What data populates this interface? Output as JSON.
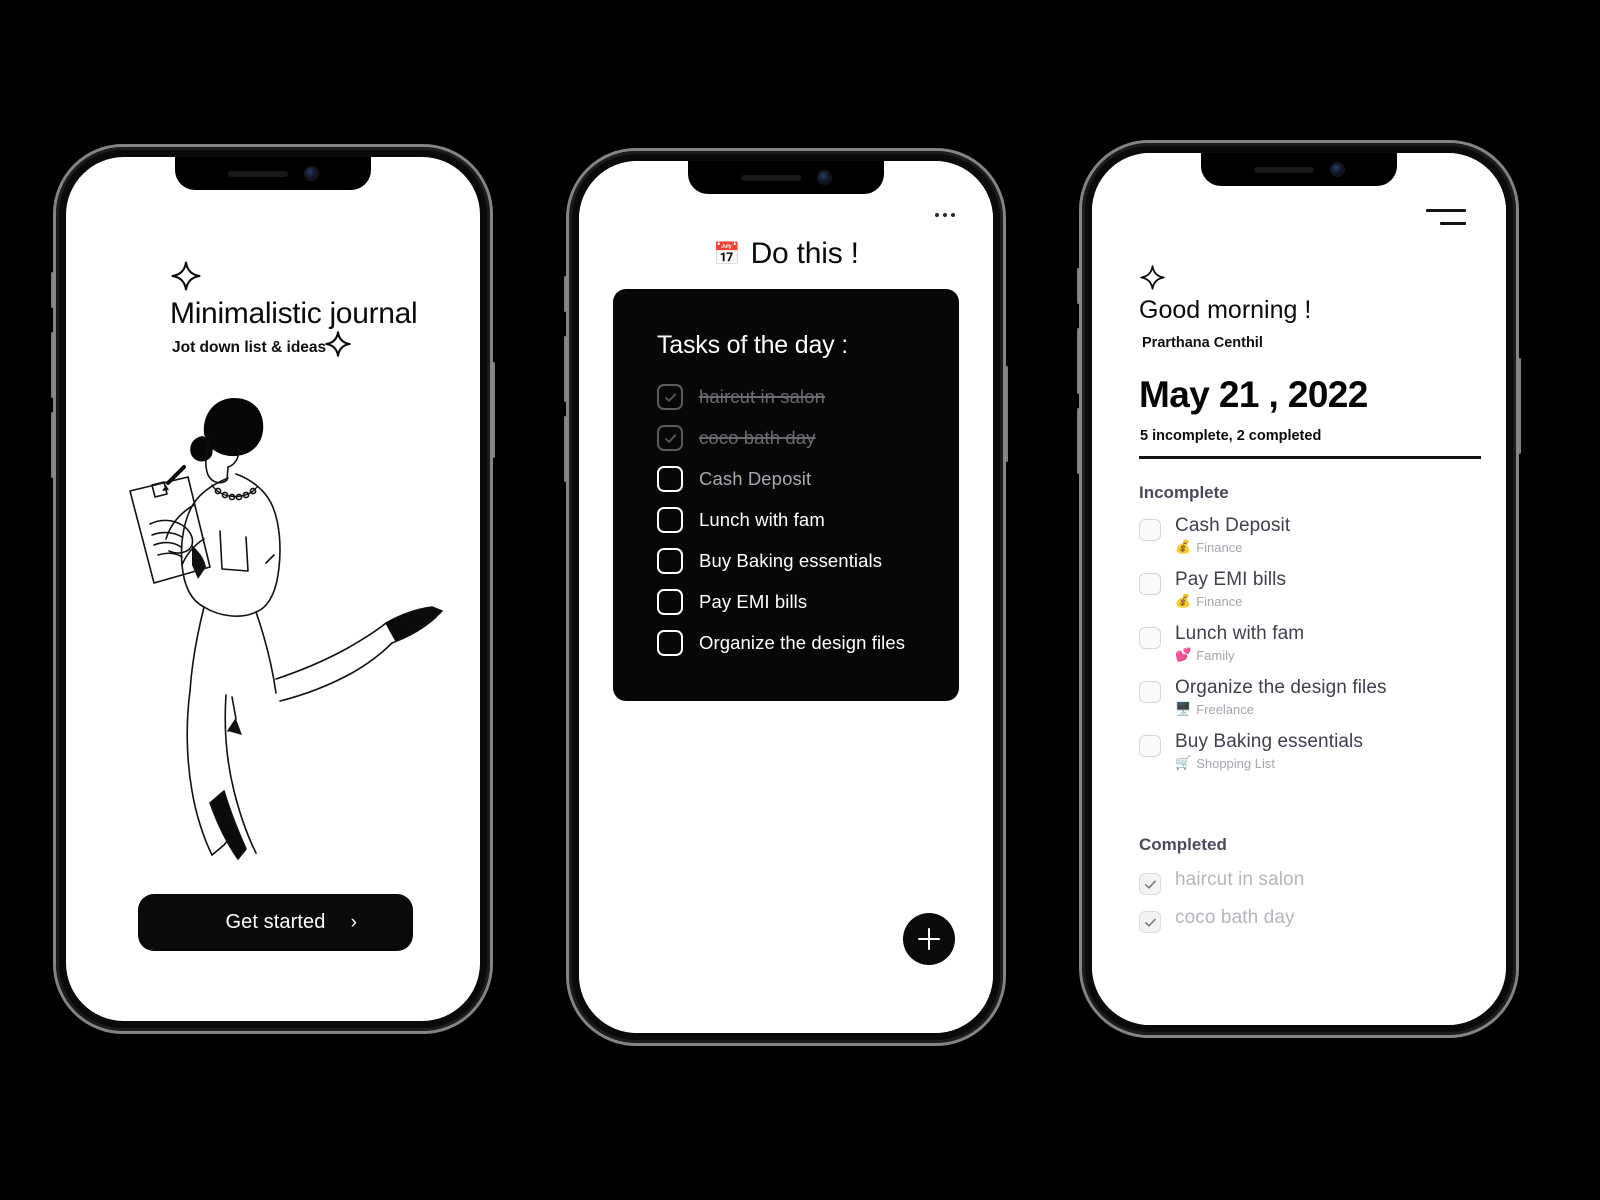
{
  "meta": {
    "accent_black": "#0a0a0a",
    "muted_gray": "#a6a6b0",
    "section_gray": "#4b4a5c"
  },
  "screen1": {
    "name": "onboarding",
    "sparkle_icon": "sparkle-icon",
    "title": "Minimalistic journal",
    "subtitle": "Jot down list & ideas",
    "illustration_alt": "woman-writing-on-clipboard-illustration",
    "cta": {
      "label": "Get started",
      "arrow": "›"
    }
  },
  "screen2": {
    "name": "tasks-of-the-day",
    "overflow_icon": "more-options-icon",
    "header_emoji": "📅",
    "header_title": "Do this !",
    "card_title": "Tasks of the day :",
    "tasks": [
      {
        "label": "haircut in salon",
        "state": "done"
      },
      {
        "label": "coco bath day",
        "state": "done"
      },
      {
        "label": "Cash Deposit",
        "state": "dim"
      },
      {
        "label": "Lunch with fam",
        "state": "open"
      },
      {
        "label": "Buy Baking essentials",
        "state": "open"
      },
      {
        "label": "Pay EMI bills",
        "state": "open"
      },
      {
        "label": "Organize the design files",
        "state": "open"
      }
    ],
    "add_button_icon": "plus-icon"
  },
  "screen3": {
    "name": "daily-agenda",
    "menu_icon": "hamburger-menu-icon",
    "sparkle_icon": "sparkle-icon",
    "greeting": "Good morning !",
    "user_name": "Prarthana Centhil",
    "date": "May 21 , 2022",
    "summary": "5 incomplete, 2 completed",
    "section_incomplete": "Incomplete",
    "section_completed": "Completed",
    "incomplete": [
      {
        "title": "Cash Deposit",
        "emoji": "💰",
        "category": "Finance"
      },
      {
        "title": "Pay EMI bills",
        "emoji": "💰",
        "category": "Finance"
      },
      {
        "title": "Lunch with fam",
        "emoji": "💕",
        "category": "Family"
      },
      {
        "title": "Organize the design files",
        "emoji": "🖥️",
        "category": "Freelance"
      },
      {
        "title": "Buy Baking essentials",
        "emoji": "🛒",
        "category": "Shopping List"
      }
    ],
    "completed": [
      {
        "title": "haircut in salon"
      },
      {
        "title": "coco bath day"
      }
    ]
  }
}
